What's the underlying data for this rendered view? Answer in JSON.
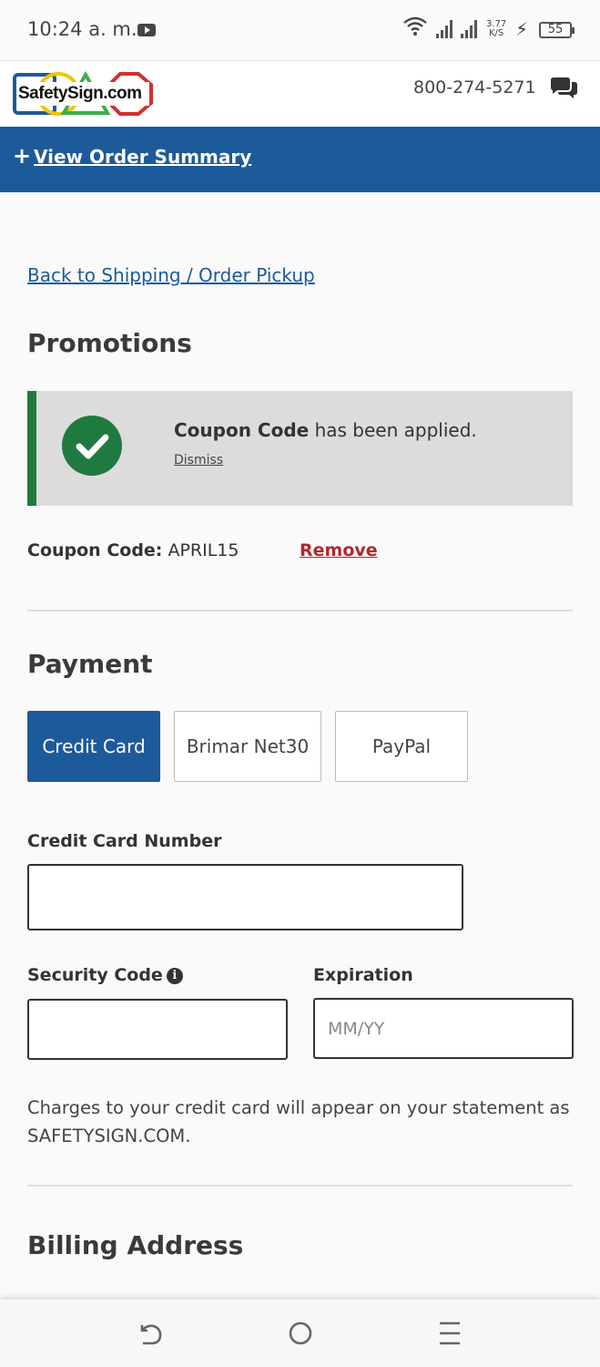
{
  "status_bar": {
    "time": "10:24 a. m.",
    "network_speed_value": "3.77",
    "network_speed_unit": "K/S",
    "battery": "55"
  },
  "header": {
    "logo_text": "SafetySign.com",
    "phone": "800-274-5271"
  },
  "summary_bar": {
    "plus": "+",
    "label": "View Order Summary"
  },
  "back_link": "Back to Shipping / Order Pickup",
  "promotions": {
    "title": "Promotions",
    "alert": {
      "strong": "Coupon Code",
      "rest": " has been applied.",
      "dismiss": "Dismiss"
    },
    "coupon_label": "Coupon Code:",
    "coupon_value": "APRIL15",
    "remove": "Remove"
  },
  "payment": {
    "title": "Payment",
    "methods": [
      {
        "label": "Credit Card",
        "active": true
      },
      {
        "label": "Brimar Net30",
        "active": false
      },
      {
        "label": "PayPal",
        "active": false
      }
    ],
    "card_number_label": "Credit Card Number",
    "card_number_value": "",
    "security_code_label": "Security Code",
    "security_code_value": "",
    "expiration_label": "Expiration",
    "expiration_placeholder": "MM/YY",
    "note": "Charges to your credit card will appear on your statement as SAFETYSIGN.COM."
  },
  "billing": {
    "title": "Billing Address"
  },
  "colors": {
    "brand_blue": "#1d5a99",
    "success_green": "#1f7a3f",
    "remove_red": "#b3262d"
  }
}
